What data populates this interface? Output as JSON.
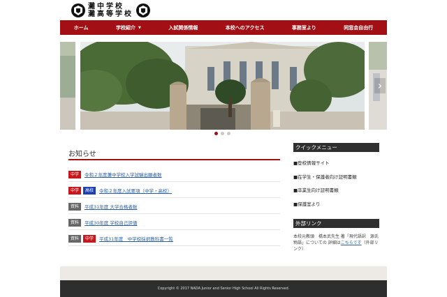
{
  "header": {
    "logo_line1": "灘中学校",
    "logo_line2": "灘高等学校"
  },
  "nav": {
    "items": [
      {
        "label": "ホーム"
      },
      {
        "label": "学校紹介"
      },
      {
        "label": "入試関係情報"
      },
      {
        "label": "本校へのアクセス"
      },
      {
        "label": "事務室より"
      },
      {
        "label": "同窓会自由行"
      }
    ]
  },
  "slider": {
    "dots": 3,
    "active_index": 0
  },
  "news": {
    "title": "お知らせ",
    "items": [
      {
        "badges": [
          {
            "text": "中学",
            "color": "#c8161d"
          }
        ],
        "text": "令和２年度灘中学校入学試験出願者数"
      },
      {
        "badges": [
          {
            "text": "中学",
            "color": "#c8161d"
          },
          {
            "text": "高校",
            "color": "#1d3fb0"
          }
        ],
        "text": "令和２年度入試要項（中学・高校）"
      },
      {
        "badges": [
          {
            "text": "資料",
            "color": "#666666"
          }
        ],
        "text": "平成31年度 大学合格者数"
      },
      {
        "badges": [
          {
            "text": "資料",
            "color": "#666666"
          }
        ],
        "text": "平成30年度 学校自己評価"
      },
      {
        "badges": [
          {
            "text": "資料",
            "color": "#666666"
          },
          {
            "text": "中学",
            "color": "#c8161d"
          }
        ],
        "text": "平成31年度　中学校採択教科書一覧"
      }
    ]
  },
  "sidebar": {
    "quick_title": "クイックメニュー",
    "quick_items": [
      "■登校情報サイト",
      "■在学生・保護者向け証明書類",
      "■卒業生向け証明書類",
      "■保護室より"
    ],
    "external_title": "外部リンク",
    "external_text_before": "本校元教頭　橋本武先生 著「現代語訳　源氏物語」についての 詳細は",
    "external_link": "こちらです",
    "external_text_after": "（外部リンク）"
  },
  "footer": {
    "copyright": "Copyright © 2017 NADA Junior and Senior High School All Rights Reserved."
  },
  "colors": {
    "brand_red": "#a20f14",
    "sidebar_header": "#2f2f2f",
    "link_blue": "#2a5fa6"
  }
}
